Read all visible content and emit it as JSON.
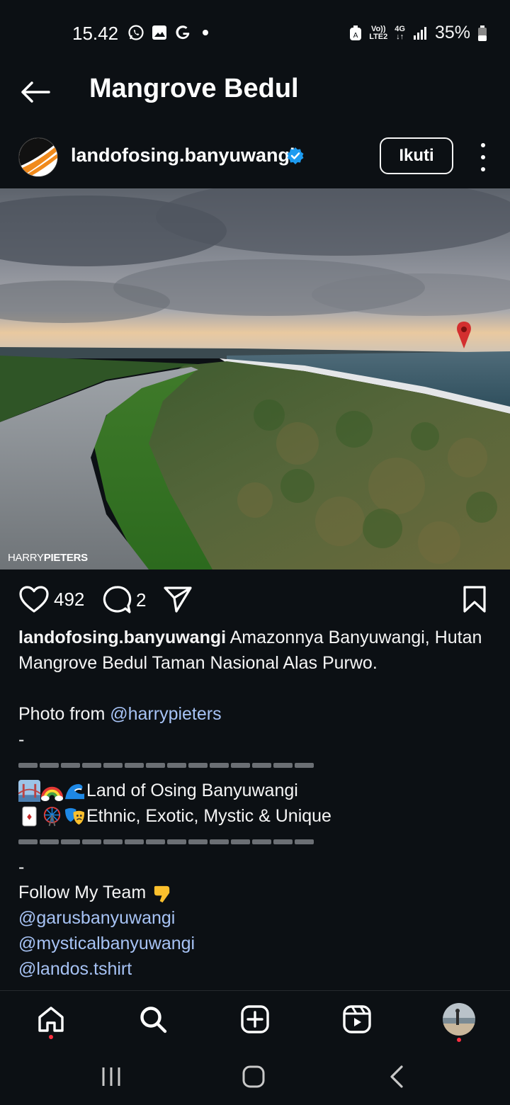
{
  "status_bar": {
    "time": "15.42",
    "battery": "35%",
    "net_top": "Vo))",
    "net_bottom": "LTE2",
    "gen_top": "4G",
    "icons": [
      "whatsapp-icon",
      "gallery-icon",
      "google-icon",
      "dot-icon",
      "alarm-icon",
      "signal-icon",
      "battery-icon"
    ]
  },
  "header": {
    "title": "Mangrove Bedul"
  },
  "post": {
    "username": "landofosing.banyuwangi",
    "verified": true,
    "follow_label": "Ikuti",
    "watermark_light": "HARRY",
    "watermark_bold": "PIETERS",
    "likes": "492",
    "comments": "2"
  },
  "caption": {
    "username": "landofosing.banyuwangi",
    "line1": " Amazonnya Banyuwangi, Hutan Mangrove Bedul Taman Nasional Alas Purwo.",
    "photo_from": "Photo from ",
    "photo_mention": "@harrypieters",
    "dash1": "-",
    "tagline1": "Land of Osing Banyuwangi",
    "tagline2": "Ethnic, Exotic, Mystic & Unique",
    "dash2": "-",
    "follow_team": "Follow My Team",
    "mentions": [
      "@garusbanyuwangi",
      "@mysticalbanyuwangi",
      "@landos.tshirt"
    ]
  },
  "colors": {
    "background": "#0c1014",
    "text": "#f5f5f5",
    "mention": "#a7c3f5",
    "verified": "#1d9bf0",
    "notification": "#ff3040",
    "pin": "#d32f2f"
  }
}
